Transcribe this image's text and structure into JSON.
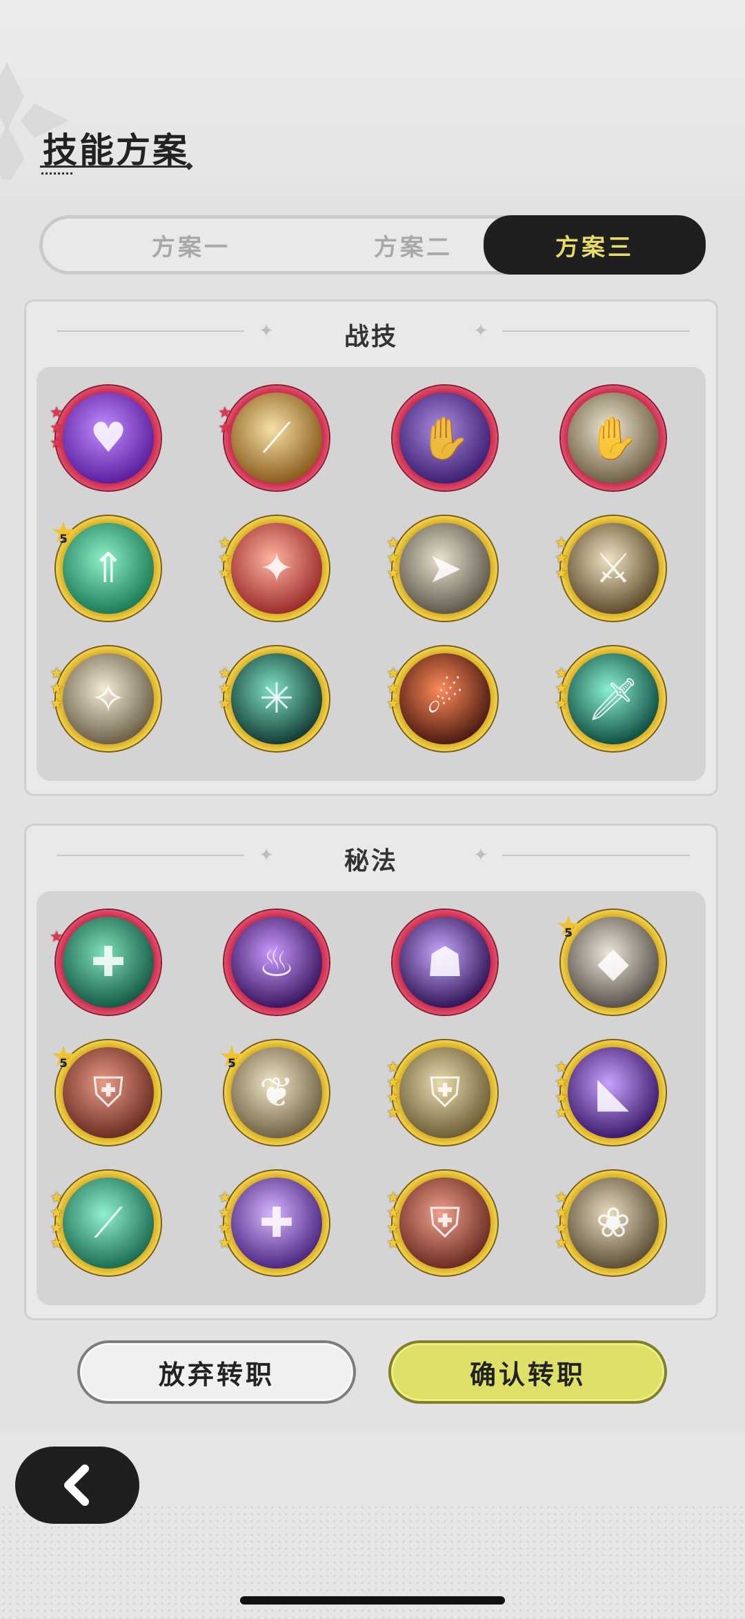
{
  "header": {
    "title": "技能方案"
  },
  "tabs": [
    {
      "label": "方案一",
      "active": false
    },
    {
      "label": "方案二",
      "active": false
    },
    {
      "label": "方案三",
      "active": true
    }
  ],
  "sections": [
    {
      "title": "战技",
      "skills": [
        {
          "icon": "purple-heart-burst-icon",
          "frame": "red",
          "stars": 3,
          "star_color": "red",
          "badge": ""
        },
        {
          "icon": "golden-slash-icon",
          "frame": "red",
          "stars": 2,
          "star_color": "red",
          "badge": ""
        },
        {
          "icon": "purple-claw-icon",
          "frame": "red",
          "stars": 0,
          "star_color": "",
          "badge": ""
        },
        {
          "icon": "grasping-hand-icon",
          "frame": "red",
          "stars": 0,
          "star_color": "",
          "badge": ""
        },
        {
          "icon": "green-upward-arrows-icon",
          "frame": "gold",
          "stars": 0,
          "star_color": "",
          "badge": "5"
        },
        {
          "icon": "red-warrior-burst-icon",
          "frame": "gold",
          "stars": 3,
          "star_color": "gold",
          "badge": ""
        },
        {
          "icon": "afterimage-dash-icon",
          "frame": "gold",
          "stars": 3,
          "star_color": "gold",
          "badge": ""
        },
        {
          "icon": "sword-swing-icon",
          "frame": "gold",
          "stars": 3,
          "star_color": "gold",
          "badge": ""
        },
        {
          "icon": "leaping-strike-icon",
          "frame": "gold",
          "stars": 3,
          "star_color": "gold",
          "badge": ""
        },
        {
          "icon": "spider-web-icon",
          "frame": "gold",
          "stars": 3,
          "star_color": "gold",
          "badge": ""
        },
        {
          "icon": "fire-slash-icon",
          "frame": "gold",
          "stars": 3,
          "star_color": "gold",
          "badge": ""
        },
        {
          "icon": "green-sword-icon",
          "frame": "gold",
          "stars": 3,
          "star_color": "gold",
          "badge": ""
        }
      ]
    },
    {
      "title": "秘法",
      "skills": [
        {
          "icon": "green-heal-plus-icon",
          "frame": "red",
          "stars": 1,
          "star_color": "red",
          "badge": ""
        },
        {
          "icon": "purple-flame-icon",
          "frame": "red",
          "stars": 0,
          "star_color": "",
          "badge": ""
        },
        {
          "icon": "purple-figure-glow-icon",
          "frame": "red",
          "stars": 0,
          "star_color": "",
          "badge": ""
        },
        {
          "icon": "crystal-shard-icon",
          "frame": "gold",
          "stars": 0,
          "star_color": "",
          "badge": "5"
        },
        {
          "icon": "red-chain-shield-icon",
          "frame": "gold",
          "stars": 0,
          "star_color": "",
          "badge": "5"
        },
        {
          "icon": "golden-leaf-icon",
          "frame": "gold",
          "stars": 0,
          "star_color": "",
          "badge": "5"
        },
        {
          "icon": "golden-armor-icon",
          "frame": "gold",
          "stars": 4,
          "star_color": "gold",
          "badge": ""
        },
        {
          "icon": "purple-beast-icon",
          "frame": "gold",
          "stars": 4,
          "star_color": "gold",
          "badge": ""
        },
        {
          "icon": "green-blade-icon",
          "frame": "gold",
          "stars": 4,
          "star_color": "gold",
          "badge": ""
        },
        {
          "icon": "purple-orb-heal-icon",
          "frame": "gold",
          "stars": 4,
          "star_color": "gold",
          "badge": ""
        },
        {
          "icon": "red-armor-icon",
          "frame": "gold",
          "stars": 4,
          "star_color": "gold",
          "badge": ""
        },
        {
          "icon": "golden-dragon-icon",
          "frame": "gold",
          "stars": 4,
          "star_color": "gold",
          "badge": ""
        }
      ]
    }
  ],
  "buttons": {
    "abandon": "放弃转职",
    "confirm": "确认转职"
  },
  "back": {
    "icon": "chevron-left-icon"
  },
  "colors": {
    "tab_active_bg": "#1f1f1f",
    "tab_active_text": "#e6dc67",
    "confirm_bg": "#dfe068"
  }
}
